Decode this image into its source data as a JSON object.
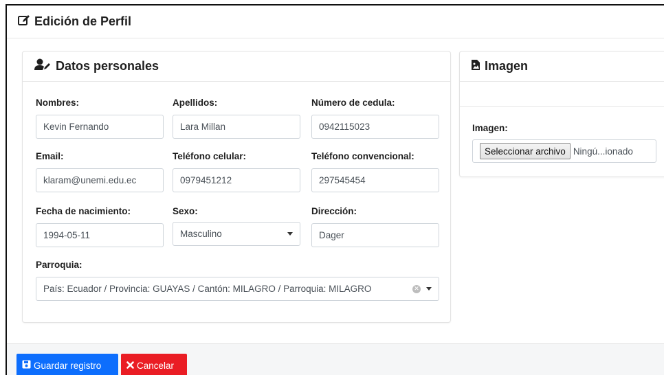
{
  "page": {
    "title": "Edición de Perfil"
  },
  "personal": {
    "title": "Datos personales",
    "fields": {
      "nombres": {
        "label": "Nombres:",
        "value": "Kevin Fernando"
      },
      "apellidos": {
        "label": "Apellidos:",
        "value": "Lara Millan"
      },
      "cedula": {
        "label": "Número de cedula:",
        "value": "0942115023"
      },
      "email": {
        "label": "Email:",
        "value": "klaram@unemi.edu.ec"
      },
      "celular": {
        "label": "Teléfono celular:",
        "value": "0979451212"
      },
      "convencional": {
        "label": "Teléfono convencional:",
        "value": "297545454"
      },
      "nacimiento": {
        "label": "Fecha de nacimiento:",
        "value": "1994-05-11"
      },
      "sexo": {
        "label": "Sexo:",
        "value": "Masculino"
      },
      "direccion": {
        "label": "Dirección:",
        "value": "Dager"
      },
      "parroquia": {
        "label": "Parroquia:",
        "value": "País: Ecuador / Provincia: GUAYAS / Cantón: MILAGRO / Parroquia: MILAGRO"
      }
    }
  },
  "image": {
    "title": "Imagen",
    "label": "Imagen:",
    "file_button": "Seleccionar archivo",
    "file_status": "Ningú...ionado"
  },
  "footer": {
    "save_label": "Guardar registro",
    "cancel_label": "Cancelar"
  },
  "colors": {
    "primary": "#0d6efd",
    "danger": "#ea1d24",
    "footer_bg": "#f5f6f7"
  },
  "icons": {
    "page_title": "edit-icon",
    "personal_title": "user-edit-icon",
    "image_title": "image-file-icon",
    "save": "save-icon",
    "cancel": "times-icon"
  }
}
